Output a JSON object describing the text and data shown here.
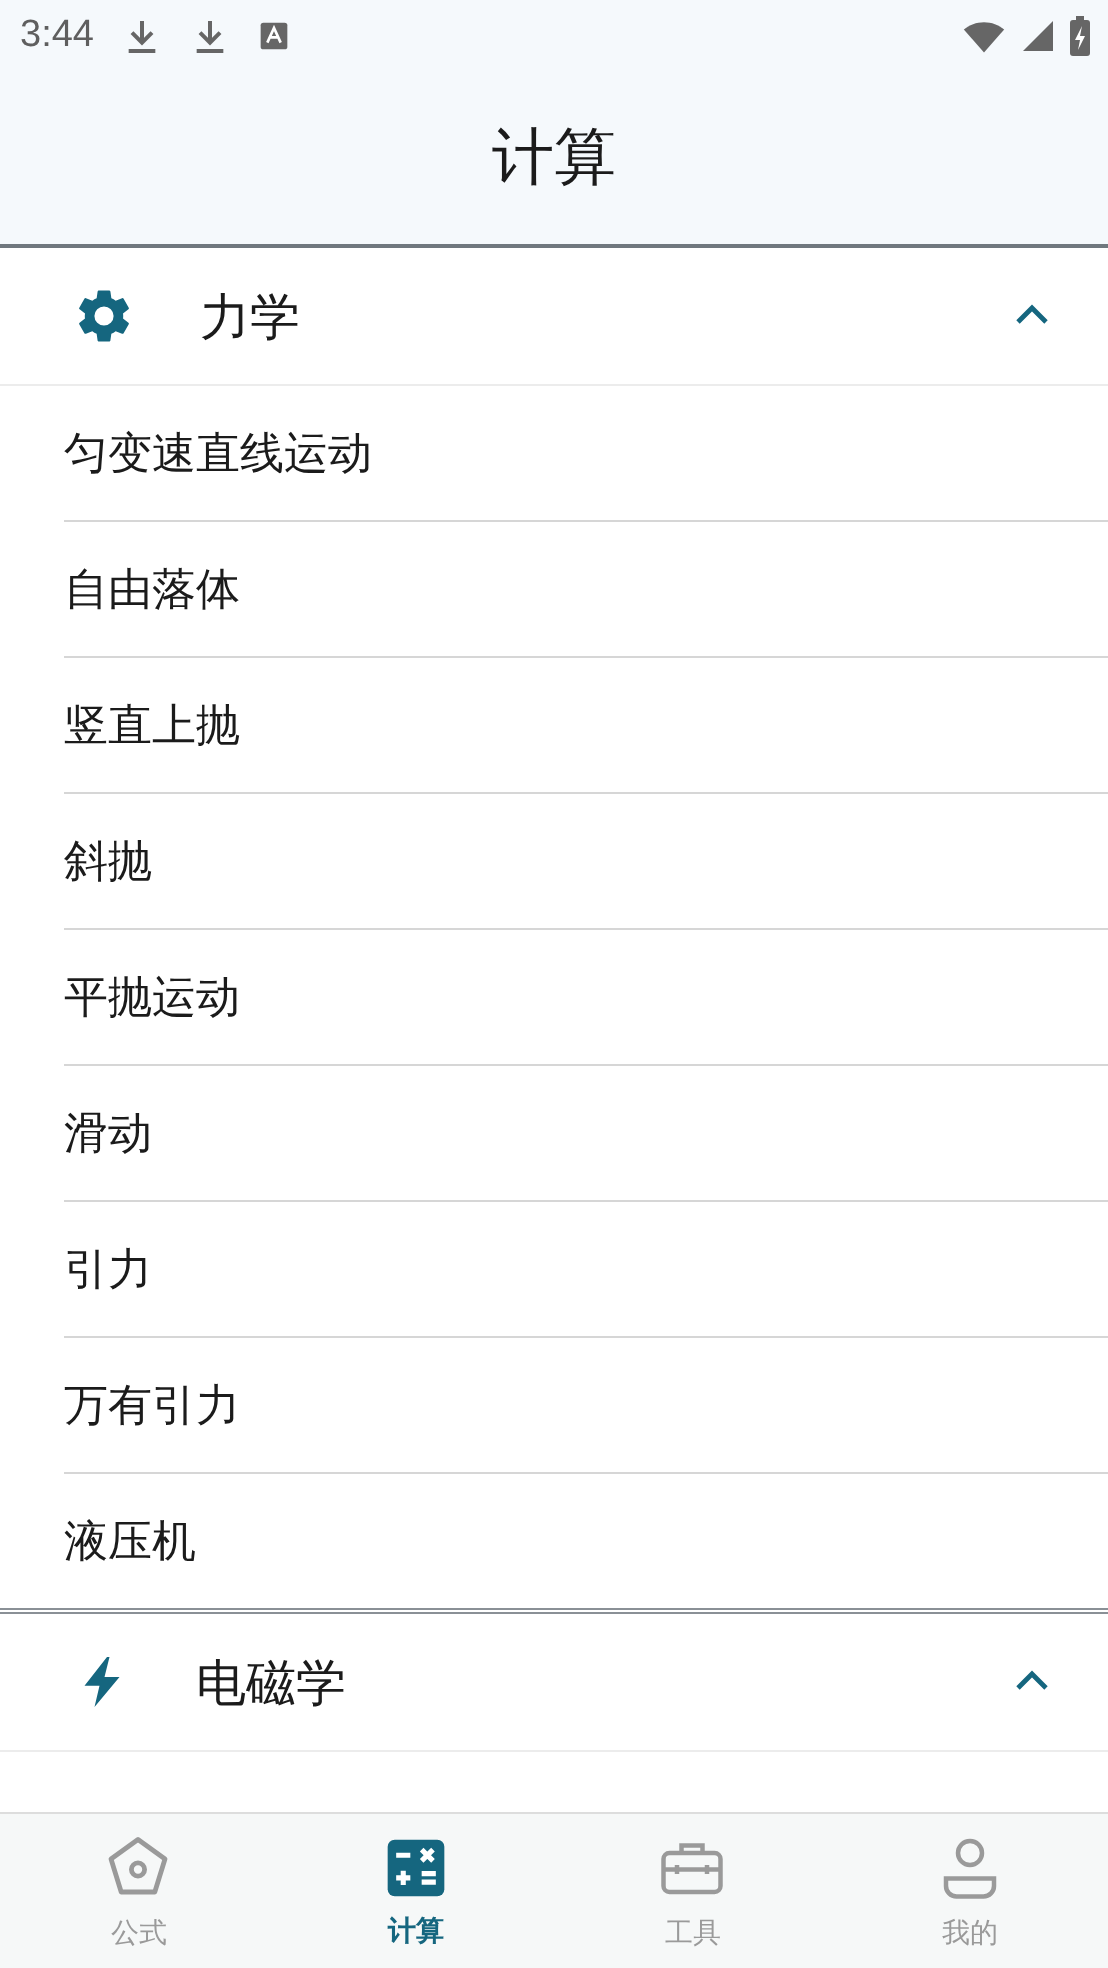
{
  "status_bar": {
    "time": "3:44"
  },
  "title": "计算",
  "sections": [
    {
      "kind": "gear",
      "title": "力学",
      "expanded": true,
      "items": [
        "匀变速直线运动",
        "自由落体",
        "竖直上抛",
        "斜抛",
        "平抛运动",
        "滑动",
        "引力",
        "万有引力",
        "液压机"
      ]
    },
    {
      "kind": "bolt",
      "title": "电磁学",
      "expanded": true
    }
  ],
  "nav": [
    {
      "kind": "formula",
      "label": "公式",
      "selected": false
    },
    {
      "kind": "calc",
      "label": "计算",
      "selected": true
    },
    {
      "kind": "tools",
      "label": "工具",
      "selected": false
    },
    {
      "kind": "me",
      "label": "我的",
      "selected": false
    }
  ]
}
